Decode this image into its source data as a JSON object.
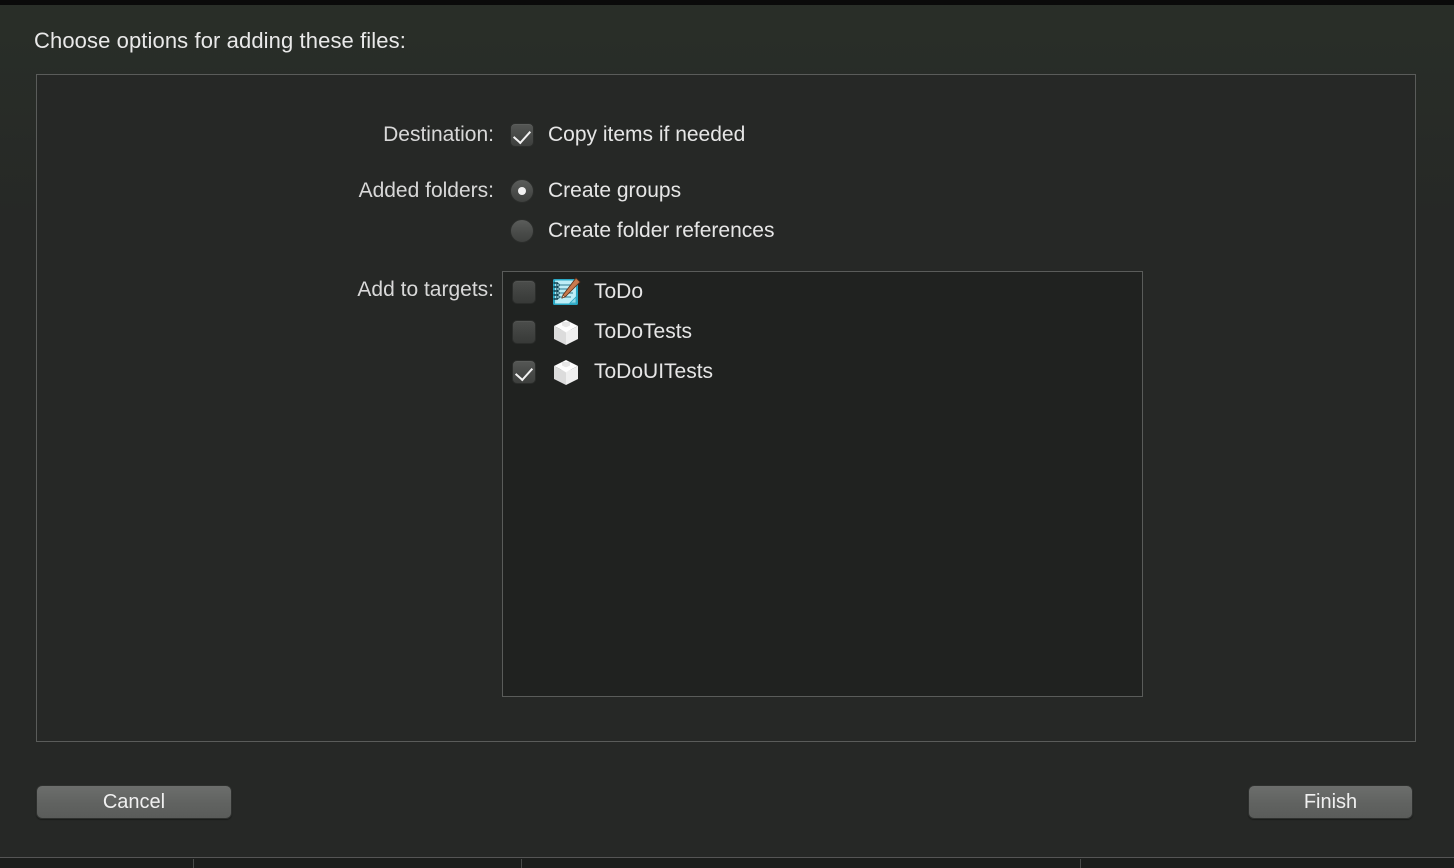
{
  "dialog": {
    "title": "Choose options for adding these files:"
  },
  "form": {
    "destination": {
      "label": "Destination:",
      "copy_items": {
        "label": "Copy items if needed",
        "checked": true,
        "icon": "checkbox-checked-icon"
      }
    },
    "added_folders": {
      "label": "Added folders:",
      "options": [
        {
          "label": "Create groups",
          "selected": true,
          "icon": "radio-selected-icon"
        },
        {
          "label": "Create folder references",
          "selected": false,
          "icon": "radio-unselected-icon"
        }
      ]
    },
    "add_to_targets": {
      "label": "Add to targets:",
      "targets": [
        {
          "name": "ToDo",
          "checked": false,
          "icon": "app-notepad-icon"
        },
        {
          "name": "ToDoTests",
          "checked": false,
          "icon": "test-bundle-icon"
        },
        {
          "name": "ToDoUITests",
          "checked": true,
          "icon": "test-bundle-icon"
        }
      ]
    }
  },
  "footer": {
    "cancel_label": "Cancel",
    "finish_label": "Finish"
  },
  "colors": {
    "background": "#262826",
    "panel_border": "#5a5c5a",
    "list_background": "#202220",
    "text": "#e6e6e6",
    "button_face": "#616361",
    "app_icon_accent": "#7fd8e8"
  }
}
